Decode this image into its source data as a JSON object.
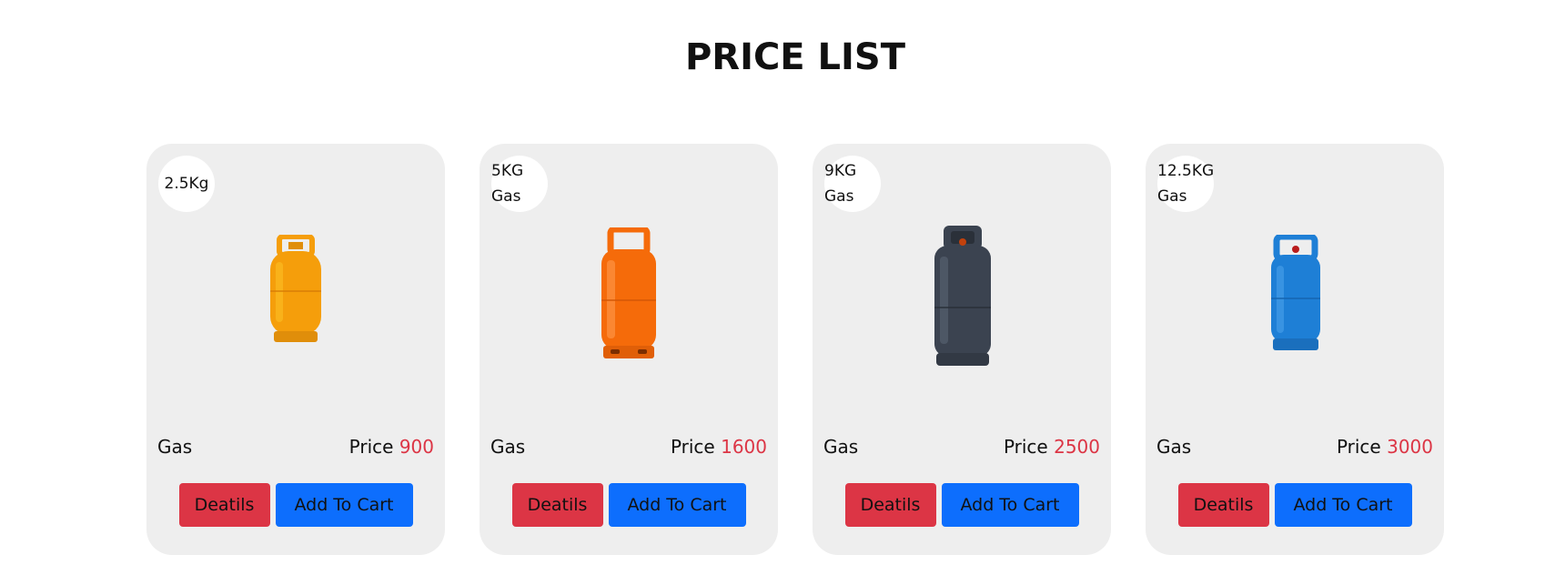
{
  "page": {
    "title": "PRICE LIST"
  },
  "products": [
    {
      "badge_line1": "2.5Kg",
      "badge_line2": "",
      "name": "Gas",
      "price_label": "Price",
      "price_value": "900",
      "details_label": "Deatils",
      "cart_label": "Add To Cart",
      "cylinder_color": "#f59e0b"
    },
    {
      "badge_line1": "5KG",
      "badge_line2": "Gas",
      "name": "Gas",
      "price_label": "Price",
      "price_value": "1600",
      "details_label": "Deatils",
      "cart_label": "Add To Cart",
      "cylinder_color": "#f56b0a"
    },
    {
      "badge_line1": "9KG",
      "badge_line2": "Gas",
      "name": "Gas",
      "price_label": "Price",
      "price_value": "2500",
      "details_label": "Deatils",
      "cart_label": "Add To Cart",
      "cylinder_color": "#3b4350"
    },
    {
      "badge_line1": "12.5KG",
      "badge_line2": "Gas",
      "name": "Gas",
      "price_label": "Price",
      "price_value": "3000",
      "details_label": "Deatils",
      "cart_label": "Add To Cart",
      "cylinder_color": "#1e7fd6"
    }
  ],
  "colors": {
    "accent_red": "#dc3545",
    "accent_blue": "#0d6efd",
    "card_bg": "#eeeeee"
  }
}
